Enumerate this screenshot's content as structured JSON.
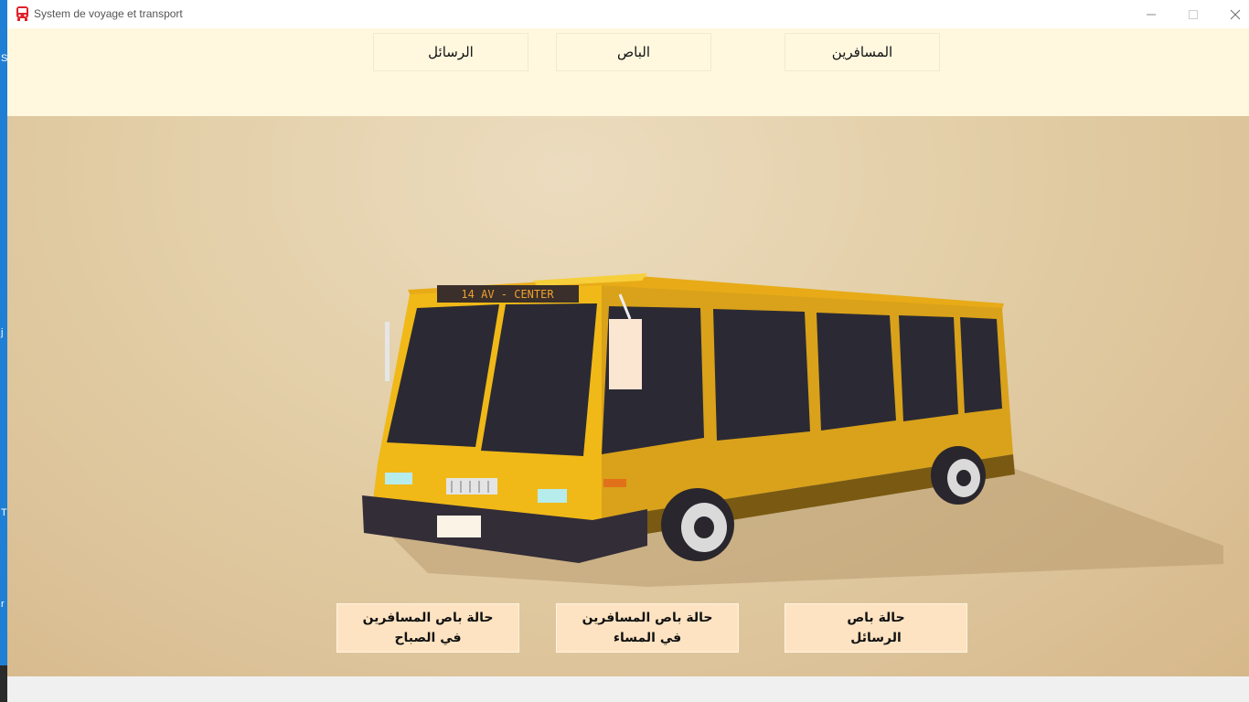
{
  "window": {
    "title": "System de voyage et transport",
    "icon": "bus-icon"
  },
  "nav": {
    "messages_label": "الرسائل",
    "bus_label": "الباص",
    "travelers_label": "المسافرين"
  },
  "hero": {
    "bus_sign": "14 AV - CENTER"
  },
  "status_buttons": {
    "morning": {
      "line1": "حالة باص المسافرين",
      "line2": "في الصباح"
    },
    "evening": {
      "line1": "حالة باص المسافرين",
      "line2": "في المساء"
    },
    "messages": {
      "line1": "حالة باص",
      "line2": "الرسائل"
    }
  },
  "colors": {
    "menu_background": "#fff8df",
    "button_background": "#fde3c2",
    "bus_yellow": "#f0b918"
  }
}
